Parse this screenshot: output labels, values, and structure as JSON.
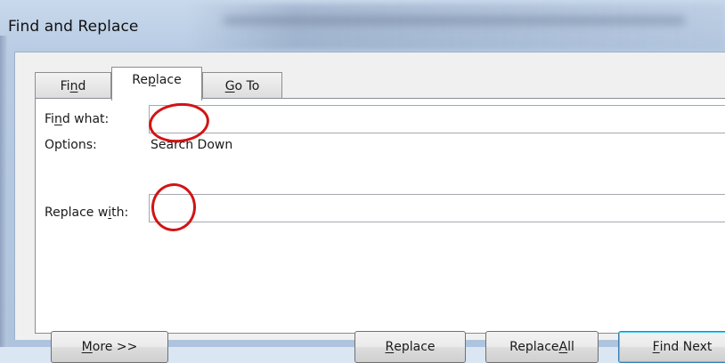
{
  "window": {
    "title": "Find and Replace"
  },
  "tabs": [
    {
      "label_parts": [
        "Fi",
        "n",
        "d"
      ],
      "selected": false
    },
    {
      "label_parts": [
        "Re",
        "p",
        "lace"
      ],
      "selected": true
    },
    {
      "label_parts": [
        "",
        "G",
        "o To"
      ],
      "selected": false
    }
  ],
  "find_row": {
    "label_parts": [
      "Fi",
      "n",
      "d what:"
    ],
    "value": ""
  },
  "options_row": {
    "label": "Options:",
    "value": "Search Down"
  },
  "replace_row": {
    "label_parts": [
      "Replace w",
      "i",
      "th:"
    ],
    "value": ""
  },
  "buttons": {
    "more": {
      "label_parts": [
        "",
        "M",
        "ore >>"
      ]
    },
    "replace": {
      "label_parts": [
        "",
        "R",
        "eplace"
      ]
    },
    "replace_all": {
      "label_parts": [
        "Replace ",
        "A",
        "ll"
      ]
    },
    "find_next": {
      "label_parts": [
        "",
        "F",
        "ind Next"
      ]
    }
  },
  "colors": {
    "annotation": "#d11414",
    "default_button_border": "#3c7fb1"
  }
}
